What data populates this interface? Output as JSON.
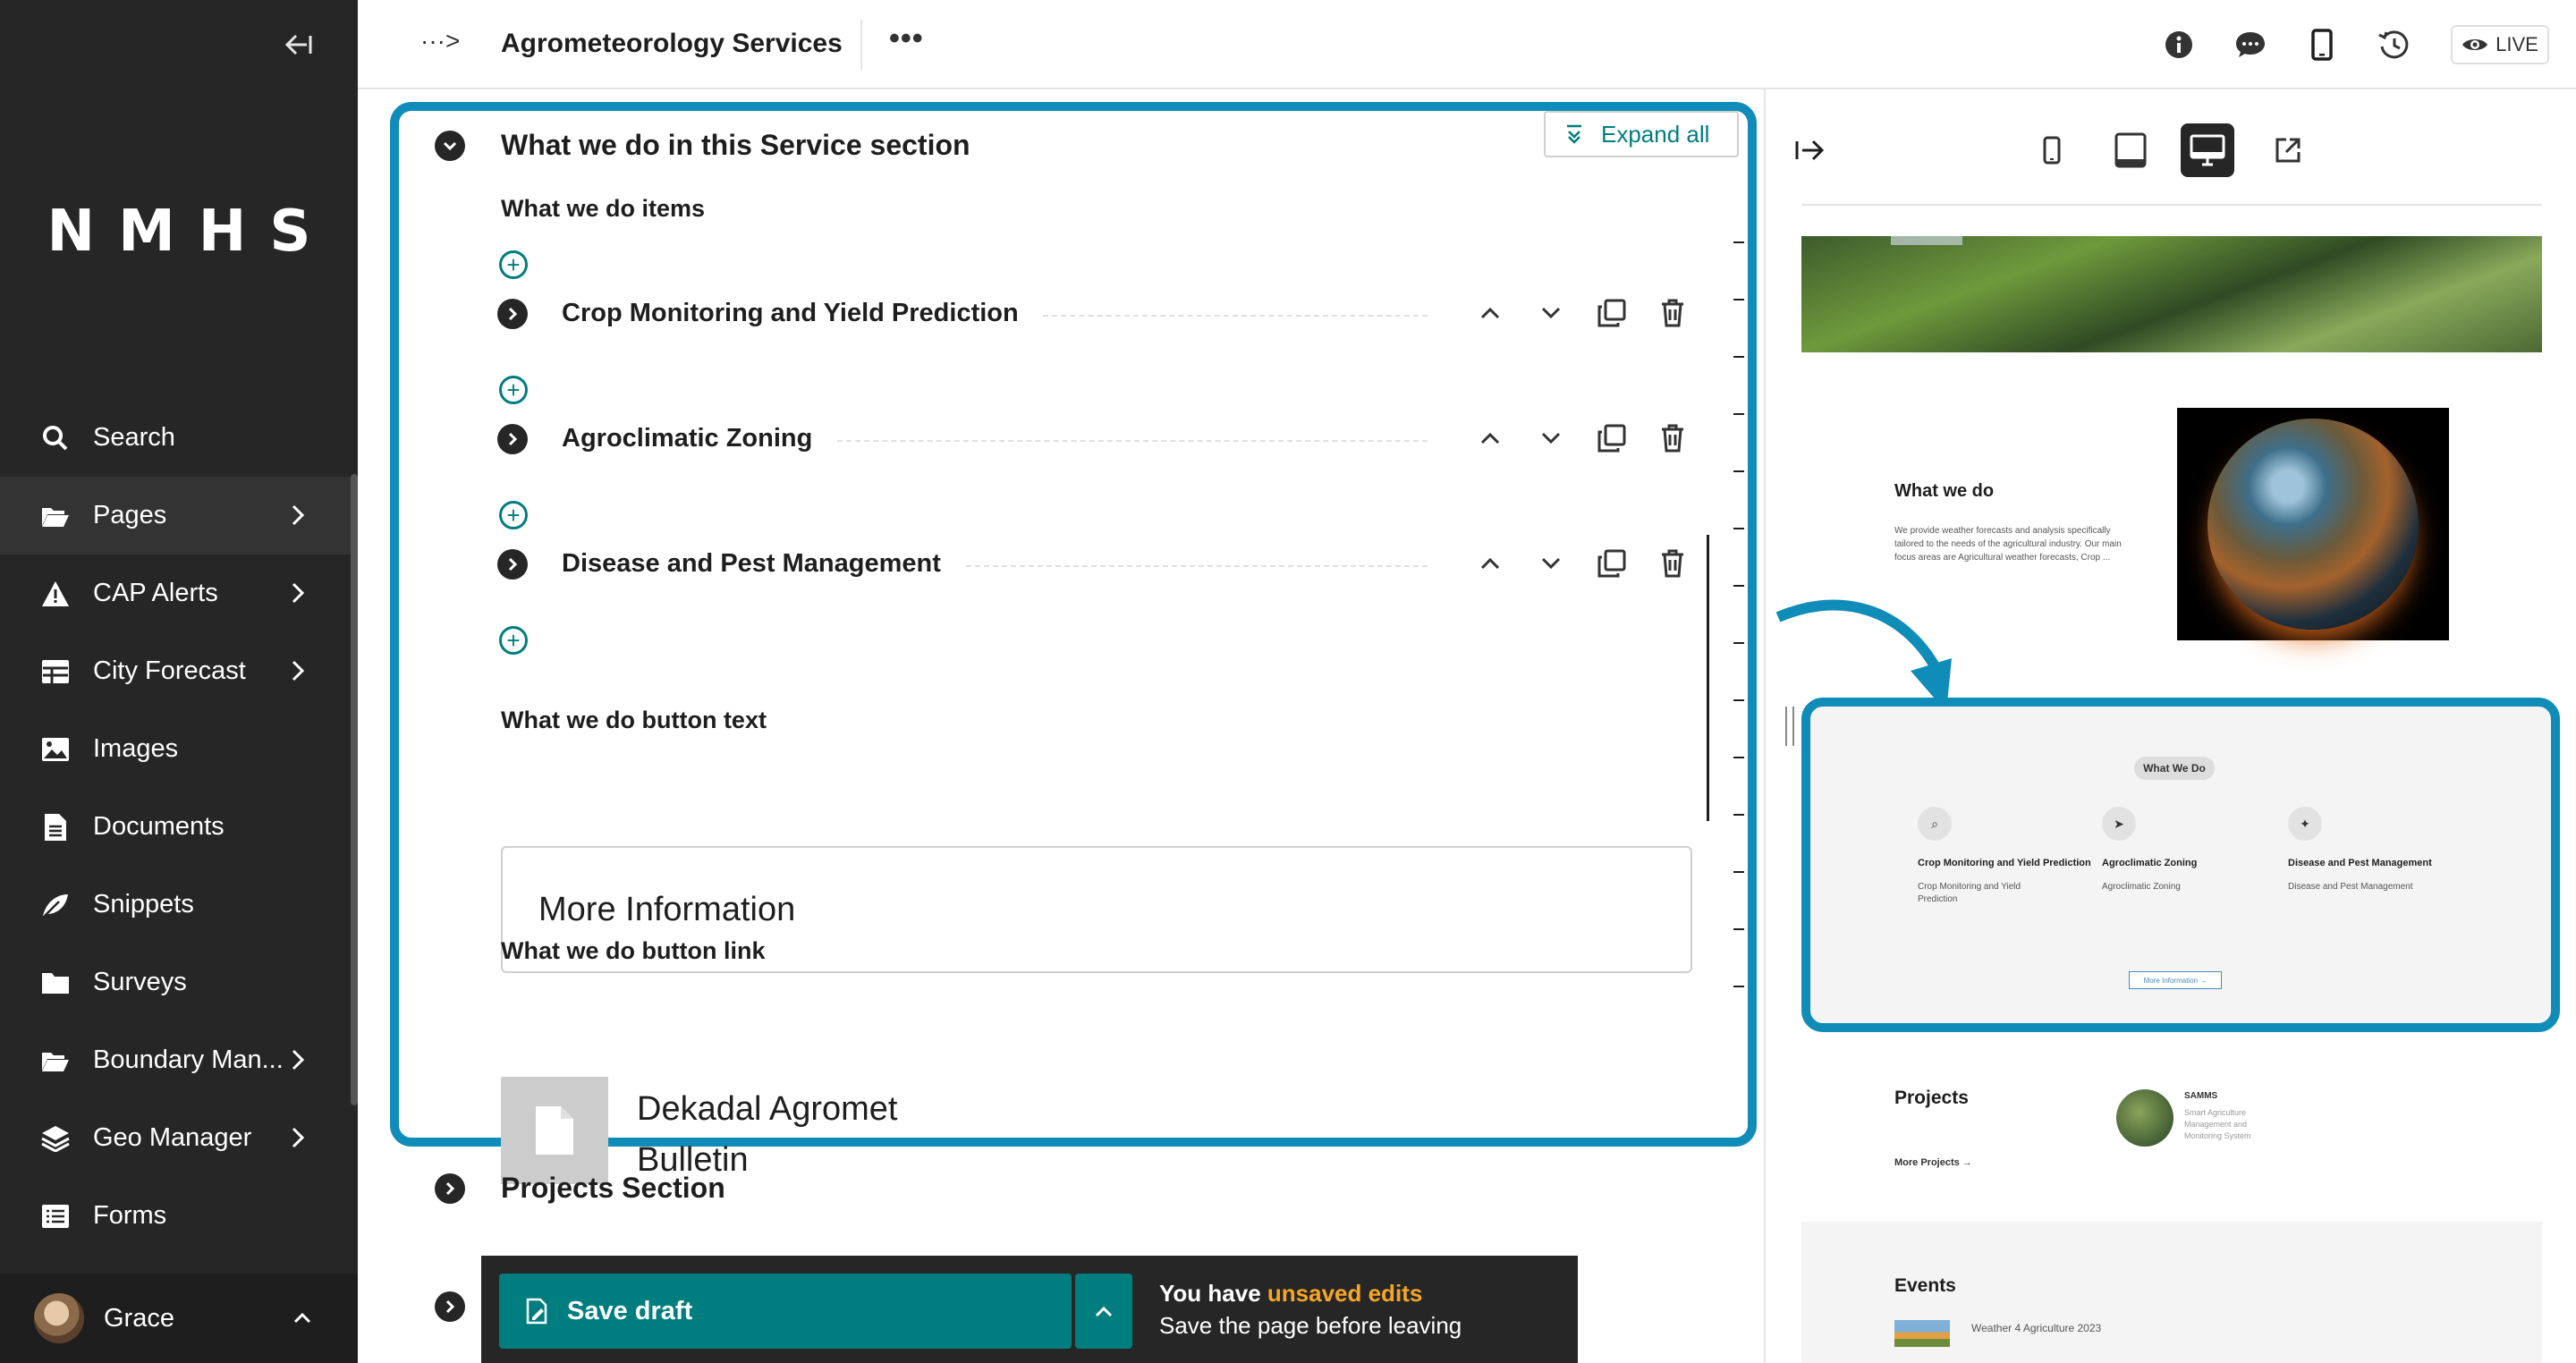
{
  "sidebar": {
    "logo": "NMHS",
    "items": [
      {
        "label": "Search",
        "icon": "search-icon"
      },
      {
        "label": "Pages",
        "icon": "folder-open-icon",
        "has_children": true
      },
      {
        "label": "CAP Alerts",
        "icon": "warning-icon",
        "has_children": true
      },
      {
        "label": "City Forecast",
        "icon": "table-icon",
        "has_children": true
      },
      {
        "label": "Images",
        "icon": "image-icon"
      },
      {
        "label": "Documents",
        "icon": "document-icon"
      },
      {
        "label": "Snippets",
        "icon": "snippet-icon"
      },
      {
        "label": "Surveys",
        "icon": "folder-icon"
      },
      {
        "label": "Boundary Man...",
        "icon": "folder-open-icon",
        "has_children": true
      },
      {
        "label": "Geo Manager",
        "icon": "layers-icon",
        "has_children": true
      },
      {
        "label": "Forms",
        "icon": "list-icon"
      }
    ],
    "user": {
      "name": "Grace"
    }
  },
  "header": {
    "crumb_toggle": "···>",
    "title": "Agrometeorology Services",
    "more_actions": "•••",
    "live_label": "LIVE"
  },
  "editor": {
    "expand_all": "Expand all",
    "section_title": "What we do in this Service section",
    "items_label": "What we do items",
    "items": [
      {
        "title": "Crop Monitoring and Yield Prediction"
      },
      {
        "title": "Agroclimatic Zoning"
      },
      {
        "title": "Disease and Pest Management"
      }
    ],
    "button_text_label": "What we do button text",
    "button_text_value": "More Information",
    "button_link_label": "What we do button link",
    "button_link_doc_line1": "Dekadal Agromet",
    "button_link_doc_line2": "Bulletin",
    "next_section_title": "Projects Section"
  },
  "save_bar": {
    "save_label": "Save draft",
    "msg_prefix": "You have ",
    "msg_highlight": "unsaved edits",
    "msg_line2": "Save the page before leaving"
  },
  "preview": {
    "whatwedo_title": "What we do",
    "whatwedo_desc": "We provide weather forecasts and analysis specifically tailored to the needs of the agricultural industry. Our main focus areas are Agricultural weather forecasts, Crop ...",
    "card": {
      "pill": "What We Do",
      "columns": [
        {
          "title": "Crop Monitoring and Yield Prediction",
          "desc": "Crop Monitoring and Yield Prediction"
        },
        {
          "title": "Agroclimatic Zoning",
          "desc": "Agroclimatic Zoning"
        },
        {
          "title": "Disease and Pest Management",
          "desc": "Disease and Pest Management"
        }
      ],
      "button": "More Information →"
    },
    "projects_title": "Projects",
    "more_projects": "More Projects →",
    "project_name": "SAMMS",
    "project_desc": "Smart Agriculture Management and Monitoring System",
    "events_title": "Events",
    "event_name": "Weather 4 Agriculture 2023"
  },
  "colors": {
    "accent_teal": "#007d7e",
    "highlight_blue": "#0f8cb7",
    "sidebar_bg": "#262626",
    "warning": "#f5a623"
  }
}
